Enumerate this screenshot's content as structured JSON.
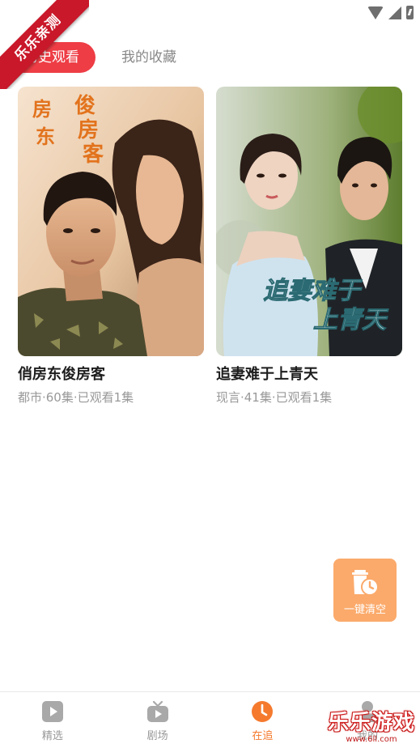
{
  "watermark": {
    "corner_text": "乐乐亲测",
    "bottom_text": "乐乐游戏",
    "bottom_url": "www.6ll.com"
  },
  "tabs": [
    {
      "label": "历史观看",
      "active": true
    },
    {
      "label": "我的收藏",
      "active": false
    }
  ],
  "cards": [
    {
      "title": "俏房东俊房客",
      "meta": "都市·60集·已观看1集",
      "poster_text": [
        "俊",
        "房",
        "客",
        "房",
        "东"
      ]
    },
    {
      "title": "追妻难于上青天",
      "meta": "现言·41集·已观看1集",
      "poster_text": [
        "追妻难于",
        "上青天"
      ]
    }
  ],
  "clear_button": {
    "label": "一键清空",
    "icon": "trash-clock-icon"
  },
  "bottom_nav": [
    {
      "label": "精选",
      "icon": "play-icon",
      "active": false
    },
    {
      "label": "剧场",
      "icon": "tv-icon",
      "active": false
    },
    {
      "label": "在追",
      "icon": "clock-icon",
      "active": true
    },
    {
      "label": "我的",
      "icon": "person-icon",
      "active": false
    }
  ],
  "colors": {
    "accent": "#ee3d45",
    "nav_active": "#f57a2e",
    "clear_button": "#fbaa6b"
  }
}
